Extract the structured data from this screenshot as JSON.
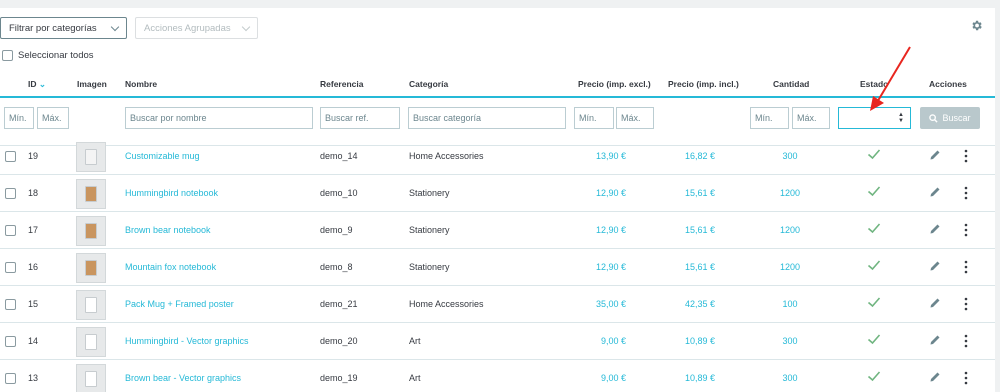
{
  "toolbar": {
    "filter_label": "Filtrar por categorías",
    "bulk_label": "Acciones Agrupadas",
    "settings_icon": "gear-icon"
  },
  "select_all_label": "Seleccionar todos",
  "columns": [
    "ID",
    "Imagen",
    "Nombre",
    "Referencia",
    "Categoría",
    "Precio (imp. excl.)",
    "Precio (imp. incl.)",
    "Cantidad",
    "Estado",
    "Acciones"
  ],
  "filters": {
    "id_min": "Mín.",
    "id_max": "Máx.",
    "name": "Buscar por nombre",
    "ref": "Buscar ref.",
    "category": "Buscar categoría",
    "price_min": "Mín.",
    "price_max": "Máx.",
    "qty_min": "Mín.",
    "qty_max": "Máx.",
    "status_value": "",
    "search_label": "Buscar"
  },
  "products": [
    {
      "id": "19",
      "name": "Customizable mug",
      "ref": "demo_14",
      "category": "Home Accessories",
      "price_excl": "13,90 €",
      "price_incl": "16,82 €",
      "qty": "300",
      "thumb_color": "#f4f4f4"
    },
    {
      "id": "18",
      "name": "Hummingbird notebook",
      "ref": "demo_10",
      "category": "Stationery",
      "price_excl": "12,90 €",
      "price_incl": "15,61 €",
      "qty": "1200",
      "thumb_color": "#c9955f"
    },
    {
      "id": "17",
      "name": "Brown bear notebook",
      "ref": "demo_9",
      "category": "Stationery",
      "price_excl": "12,90 €",
      "price_incl": "15,61 €",
      "qty": "1200",
      "thumb_color": "#c9955f"
    },
    {
      "id": "16",
      "name": "Mountain fox notebook",
      "ref": "demo_8",
      "category": "Stationery",
      "price_excl": "12,90 €",
      "price_incl": "15,61 €",
      "qty": "1200",
      "thumb_color": "#c9955f"
    },
    {
      "id": "15",
      "name": "Pack Mug + Framed poster",
      "ref": "demo_21",
      "category": "Home Accessories",
      "price_excl": "35,00 €",
      "price_incl": "42,35 €",
      "qty": "100",
      "thumb_color": "#ffffff"
    },
    {
      "id": "14",
      "name": "Hummingbird - Vector graphics",
      "ref": "demo_20",
      "category": "Art",
      "price_excl": "9,00 €",
      "price_incl": "10,89 €",
      "qty": "300",
      "thumb_color": "#ffffff"
    },
    {
      "id": "13",
      "name": "Brown bear - Vector graphics",
      "ref": "demo_19",
      "category": "Art",
      "price_excl": "9,00 €",
      "price_incl": "10,89 €",
      "qty": "300",
      "thumb_color": "#ffffff"
    }
  ],
  "colors": {
    "accent": "#25b9d7",
    "check": "#70b580",
    "arrow": "#e8261f"
  }
}
